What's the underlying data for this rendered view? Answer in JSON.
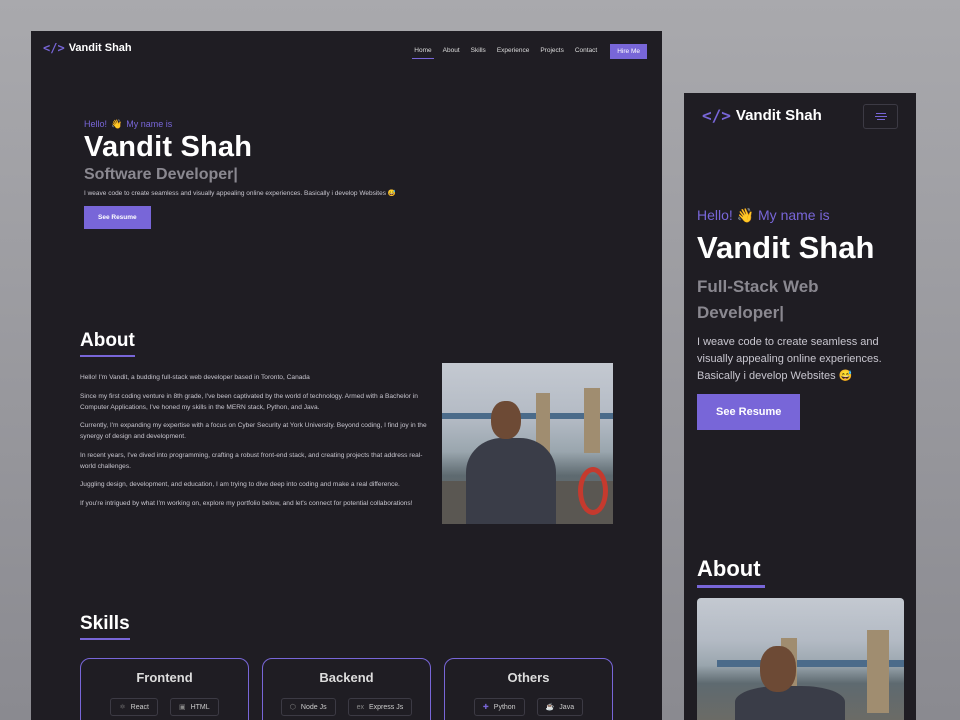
{
  "brand": {
    "name": "Vandit Shah",
    "logo_glyph": "</>"
  },
  "nav": {
    "items": [
      "Home",
      "About",
      "Skills",
      "Experience",
      "Projects",
      "Contact"
    ],
    "active": "Home",
    "hire_label": "Hire Me"
  },
  "hero": {
    "hello": "Hello!",
    "wave": "👋",
    "intro": "My name is",
    "name": "Vandit Shah",
    "role_desktop": "Software Developer|",
    "role_mobile": "Full-Stack Web Developer|",
    "tagline": "I weave code to create seamless and visually appealing online experiences. Basically i develop Websites 😅",
    "resume_label": "See Resume"
  },
  "about": {
    "heading": "About",
    "paragraphs": [
      "Hello! I'm Vandit, a budding full-stack web developer based in Toronto, Canada",
      "Since my first coding venture in 8th grade, I've been captivated by the world of technology. Armed with a Bachelor in Computer Applications, I've honed my skills in the MERN stack, Python, and Java.",
      "Currently, I'm expanding my expertise with a focus on Cyber Security at York University. Beyond coding, I find joy in the synergy of design and development.",
      "In recent years, I've dived into programming, crafting a robust front-end stack, and creating projects that address real-world challenges.",
      "Juggling design, development, and education, I am trying to dive deep into coding and make a real difference.",
      "If you're intrigued by what I'm working on, explore my portfolio below, and let's connect for potential collaborations!"
    ]
  },
  "skills": {
    "heading": "Skills",
    "cards": [
      {
        "title": "Frontend",
        "pills": [
          "React",
          "HTML"
        ]
      },
      {
        "title": "Backend",
        "pills": [
          "Node Js",
          "Express Js"
        ]
      },
      {
        "title": "Others",
        "pills": [
          "Python",
          "Java"
        ]
      }
    ]
  },
  "colors": {
    "accent": "#7866d8",
    "background": "#1f1d23"
  }
}
